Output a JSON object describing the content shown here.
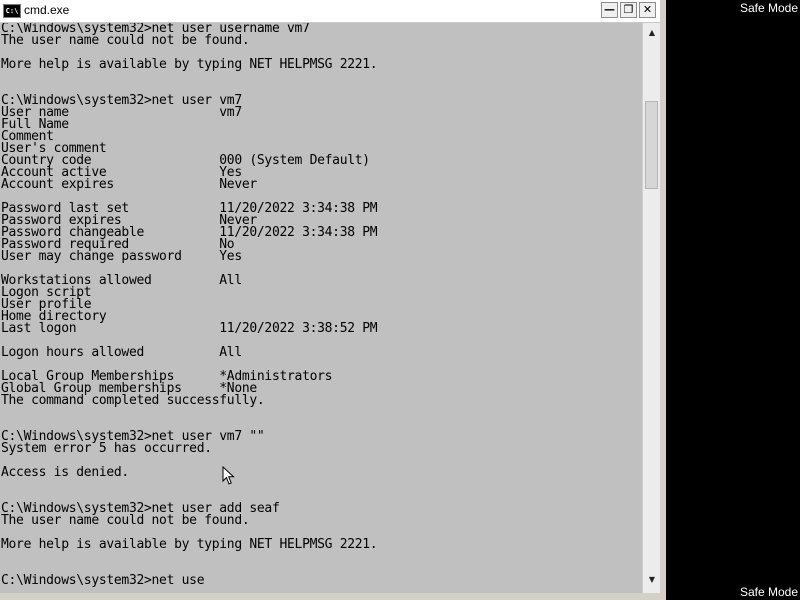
{
  "window": {
    "title": "cmd.exe",
    "icon": "C:\\",
    "buttons": {
      "minimize": "—",
      "restore": "❐",
      "close": "✕"
    }
  },
  "console": {
    "lines": [
      "C:\\Windows\\system32>net user username vm7",
      "The user name could not be found.",
      "",
      "More help is available by typing NET HELPMSG 2221.",
      "",
      "",
      "C:\\Windows\\system32>net user vm7",
      "User name                    vm7",
      "Full Name",
      "Comment",
      "User's comment",
      "Country code                 000 (System Default)",
      "Account active               Yes",
      "Account expires              Never",
      "",
      "Password last set            11/20/2022 3:34:38 PM",
      "Password expires             Never",
      "Password changeable          11/20/2022 3:34:38 PM",
      "Password required            No",
      "User may change password     Yes",
      "",
      "Workstations allowed         All",
      "Logon script",
      "User profile",
      "Home directory",
      "Last logon                   11/20/2022 3:38:52 PM",
      "",
      "Logon hours allowed          All",
      "",
      "Local Group Memberships      *Administrators",
      "Global Group memberships     *None",
      "The command completed successfully.",
      "",
      "",
      "C:\\Windows\\system32>net user vm7 \"\"",
      "System error 5 has occurred.",
      "",
      "Access is denied.",
      "",
      "",
      "C:\\Windows\\system32>net user add seaf",
      "The user name could not be found.",
      "",
      "More help is available by typing NET HELPMSG 2221.",
      "",
      "",
      "C:\\Windows\\system32>net use"
    ]
  },
  "scrollbar": {
    "up_icon": "up-arrow",
    "down_icon": "down-arrow"
  },
  "desktop": {
    "watermark_top": "Safe Mode",
    "watermark_bottom": "Safe Mode"
  }
}
